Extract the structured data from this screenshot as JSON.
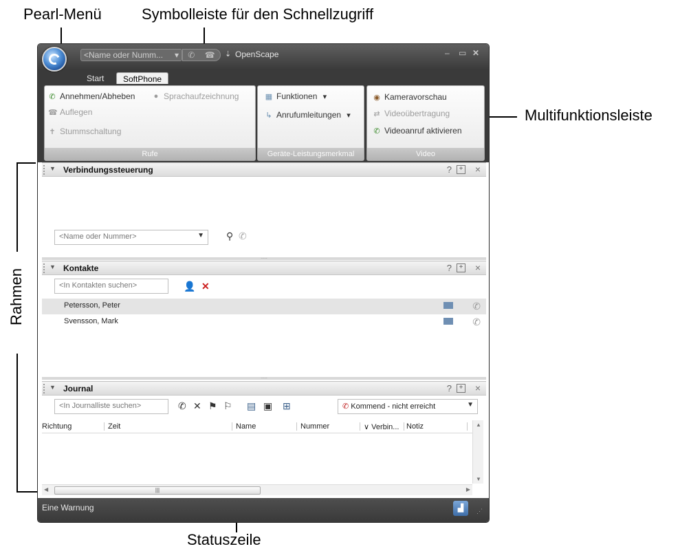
{
  "callouts": {
    "pearl_menu": "Pearl-Menü",
    "quick_access": "Symbolleiste für den Schnellzugriff",
    "ribbon": "Multifunktionsleiste",
    "frames": "Rahmen",
    "statusbar": "Statuszeile"
  },
  "window": {
    "title": "OpenScape",
    "quick_access_placeholder": "<Name oder Numm...",
    "tabs": [
      {
        "label": "Start",
        "active": false
      },
      {
        "label": "SoftPhone",
        "active": true
      }
    ]
  },
  "ribbon": {
    "groups": [
      {
        "label": "Rufe",
        "items": [
          {
            "label": "Annehmen/Abheben",
            "enabled": true,
            "icon": "phone-answer-icon"
          },
          {
            "label": "Sprachaufzeichnung",
            "enabled": false,
            "icon": "record-icon"
          },
          {
            "label": "Auflegen",
            "enabled": false,
            "icon": "hangup-icon"
          },
          {
            "label": "Stummschaltung",
            "enabled": false,
            "icon": "mute-icon"
          }
        ]
      },
      {
        "label": "Geräte-Leistungsmerkmal",
        "items": [
          {
            "label": "Funktionen",
            "enabled": true,
            "icon": "keypad-icon"
          },
          {
            "label": "Anrufumleitungen",
            "enabled": true,
            "icon": "forward-icon"
          }
        ]
      },
      {
        "label": "Video",
        "items": [
          {
            "label": "Kameravorschau",
            "enabled": true,
            "icon": "camera-icon"
          },
          {
            "label": "Videoübertragung",
            "enabled": false,
            "icon": "video-transfer-icon"
          },
          {
            "label": "Videoanruf aktivieren",
            "enabled": true,
            "icon": "video-call-icon"
          }
        ]
      }
    ]
  },
  "panels": {
    "connection": {
      "title": "Verbindungssteuerung",
      "input_placeholder": "<Name oder Nummer>"
    },
    "contacts": {
      "title": "Kontakte",
      "search_placeholder": "<In Kontakten suchen>",
      "rows": [
        "Petersson, Peter",
        "Svensson, Mark"
      ]
    },
    "journal": {
      "title": "Journal",
      "search_placeholder": "<In Journalliste suchen>",
      "filter_value": "Kommend - nicht erreicht",
      "columns": [
        "Richtung",
        "Zeit",
        "Name",
        "Nummer",
        "Verbin...",
        "Notiz"
      ]
    }
  },
  "panel_buttons": {
    "help": "?",
    "maximize": "+",
    "close": "×"
  },
  "status": {
    "text": "Eine Warnung"
  }
}
